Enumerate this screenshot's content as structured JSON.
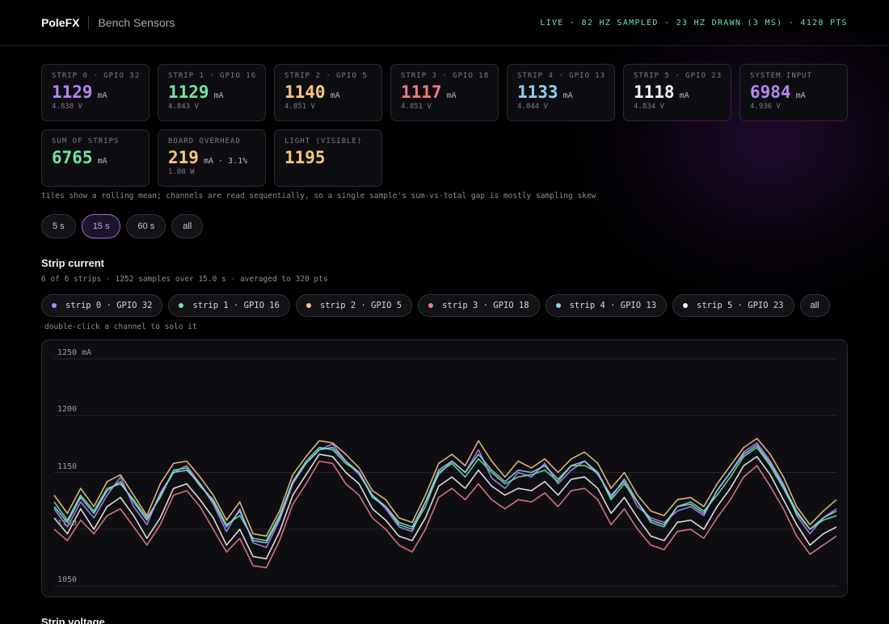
{
  "header": {
    "brand": "PoleFX",
    "subtitle": "Bench Sensors",
    "status": "LIVE · 82 HZ SAMPLED · 23 HZ DRAWN (3 MS) · 4128 PTS"
  },
  "tiles": [
    {
      "label": "STRIP 0 · GPIO 32",
      "value": "1129",
      "unit": "mA",
      "sub": "4.838 V",
      "color": "#b586f5"
    },
    {
      "label": "STRIP 1 · GPIO 16",
      "value": "1129",
      "unit": "mA",
      "sub": "4.843 V",
      "color": "#6ee7a0"
    },
    {
      "label": "STRIP 2 · GPIO 5",
      "value": "1140",
      "unit": "mA",
      "sub": "4.851 V",
      "color": "#f8c77a"
    },
    {
      "label": "STRIP 3 · GPIO 18",
      "value": "1117",
      "unit": "mA",
      "sub": "4.851 V",
      "color": "#f07a86"
    },
    {
      "label": "STRIP 4 · GPIO 13",
      "value": "1133",
      "unit": "mA",
      "sub": "4.844 V",
      "color": "#8fd0f6"
    },
    {
      "label": "STRIP 5 · GPIO 23",
      "value": "1118",
      "unit": "mA",
      "sub": "4.834 V",
      "color": "#f4f4f6"
    },
    {
      "label": "SYSTEM INPUT",
      "value": "6984",
      "unit": "mA",
      "sub": "4.936 V",
      "color": "#b586f5"
    },
    {
      "label": "SUM OF STRIPS",
      "value": "6765",
      "unit": "mA",
      "sub": "",
      "color": "#6ee7a0"
    },
    {
      "label": "BOARD OVERHEAD",
      "value": "219",
      "unit": "mA · 3.1%",
      "sub": "1.08 W",
      "color": "#f8c77a"
    },
    {
      "label": "LIGHT (VISIBLE)",
      "value": "1195",
      "unit": "",
      "sub": "",
      "color": "#f8c77a"
    }
  ],
  "note": "tiles show a rolling mean; channels are read sequentially, so a single sample's sum-vs-total gap is mostly sampling skew",
  "range_buttons": [
    {
      "label": "5 s",
      "active": false
    },
    {
      "label": "15 s",
      "active": true
    },
    {
      "label": "60 s",
      "active": false
    },
    {
      "label": "all",
      "active": false
    }
  ],
  "current_section": {
    "title": "Strip current",
    "meta": "6 of 6 strips · 1252 samples over 15.0 s · averaged to 320 pts",
    "channels": [
      {
        "label": "strip 0 · GPIO 32",
        "color": "#b586f5"
      },
      {
        "label": "strip 1 · GPIO 16",
        "color": "#6ee7a0"
      },
      {
        "label": "strip 2 · GPIO 5",
        "color": "#f8c77a"
      },
      {
        "label": "strip 3 · GPIO 18",
        "color": "#f07a86"
      },
      {
        "label": "strip 4 · GPIO 13",
        "color": "#8fd0f6"
      },
      {
        "label": "strip 5 · GPIO 23",
        "color": "#f4f4f6"
      }
    ],
    "all_label": "all",
    "hint": "double-click a channel to solo it"
  },
  "chart_data": {
    "type": "line",
    "ylabel": "mA",
    "ylim": [
      1050,
      1255
    ],
    "yticks": [
      1050,
      1100,
      1150,
      1200,
      1250
    ],
    "ytick_labels": [
      "1050",
      "1100",
      "1150",
      "1200",
      "1250 mA"
    ],
    "grid": true,
    "legend": "none",
    "x": [
      0,
      1,
      2,
      3,
      4,
      5,
      6,
      7,
      8,
      9,
      10,
      11,
      12,
      13,
      14,
      15,
      16,
      17,
      18,
      19,
      20,
      21,
      22,
      23,
      24,
      25,
      26,
      27,
      28,
      29,
      30,
      31,
      32,
      33,
      34,
      35,
      36,
      37,
      38,
      39,
      40,
      41,
      42,
      43,
      44,
      45,
      46,
      47,
      48,
      49,
      50,
      51,
      52,
      53,
      54,
      55,
      56,
      57,
      58,
      59
    ],
    "series": [
      {
        "name": "strip 0 · GPIO 32",
        "color": "#b586f5",
        "values": [
          1118,
          1102,
          1124,
          1110,
          1130,
          1146,
          1120,
          1104,
          1132,
          1150,
          1156,
          1140,
          1122,
          1098,
          1118,
          1088,
          1084,
          1108,
          1140,
          1158,
          1170,
          1175,
          1160,
          1148,
          1130,
          1118,
          1102,
          1098,
          1124,
          1148,
          1160,
          1150,
          1170,
          1145,
          1136,
          1150,
          1146,
          1158,
          1140,
          1152,
          1160,
          1148,
          1130,
          1142,
          1120,
          1110,
          1106,
          1116,
          1120,
          1112,
          1134,
          1150,
          1168,
          1176,
          1160,
          1140,
          1112,
          1096,
          1110,
          1118
        ]
      },
      {
        "name": "strip 1 · GPIO 16",
        "color": "#6ee7a0",
        "values": [
          1124,
          1108,
          1130,
          1116,
          1136,
          1140,
          1126,
          1110,
          1128,
          1152,
          1154,
          1138,
          1126,
          1104,
          1112,
          1092,
          1090,
          1112,
          1142,
          1160,
          1172,
          1170,
          1158,
          1150,
          1128,
          1120,
          1104,
          1100,
          1120,
          1150,
          1158,
          1146,
          1162,
          1150,
          1140,
          1146,
          1148,
          1152,
          1142,
          1156,
          1156,
          1150,
          1126,
          1140,
          1124,
          1106,
          1102,
          1120,
          1124,
          1116,
          1130,
          1146,
          1164,
          1172,
          1156,
          1136,
          1114,
          1100,
          1108,
          1112
        ]
      },
      {
        "name": "strip 2 · GPIO 5",
        "color": "#f8c77a",
        "values": [
          1130,
          1114,
          1136,
          1120,
          1142,
          1148,
          1130,
          1112,
          1140,
          1158,
          1160,
          1146,
          1130,
          1108,
          1124,
          1096,
          1094,
          1116,
          1148,
          1164,
          1178,
          1176,
          1166,
          1154,
          1134,
          1126,
          1110,
          1106,
          1130,
          1158,
          1166,
          1156,
          1178,
          1160,
          1146,
          1160,
          1154,
          1162,
          1150,
          1162,
          1168,
          1158,
          1136,
          1150,
          1130,
          1116,
          1112,
          1126,
          1128,
          1120,
          1140,
          1156,
          1172,
          1180,
          1166,
          1146,
          1120,
          1104,
          1116,
          1126
        ]
      },
      {
        "name": "strip 3 · GPIO 18",
        "color": "#f07a86",
        "values": [
          1100,
          1090,
          1108,
          1096,
          1112,
          1118,
          1102,
          1086,
          1104,
          1130,
          1134,
          1120,
          1100,
          1080,
          1092,
          1068,
          1066,
          1090,
          1122,
          1140,
          1160,
          1158,
          1140,
          1130,
          1110,
          1100,
          1086,
          1080,
          1100,
          1128,
          1136,
          1126,
          1140,
          1126,
          1118,
          1126,
          1124,
          1132,
          1120,
          1134,
          1136,
          1126,
          1104,
          1118,
          1100,
          1086,
          1082,
          1098,
          1100,
          1092,
          1110,
          1126,
          1146,
          1156,
          1138,
          1118,
          1094,
          1078,
          1086,
          1094
        ]
      },
      {
        "name": "strip 4 · GPIO 13",
        "color": "#8fd0f6",
        "values": [
          1120,
          1106,
          1128,
          1114,
          1134,
          1142,
          1124,
          1108,
          1130,
          1150,
          1152,
          1140,
          1124,
          1102,
          1116,
          1090,
          1088,
          1110,
          1142,
          1158,
          1170,
          1172,
          1160,
          1150,
          1130,
          1120,
          1106,
          1102,
          1124,
          1152,
          1160,
          1150,
          1166,
          1152,
          1142,
          1152,
          1150,
          1156,
          1144,
          1156,
          1160,
          1150,
          1128,
          1144,
          1124,
          1108,
          1104,
          1120,
          1122,
          1114,
          1134,
          1150,
          1166,
          1174,
          1158,
          1138,
          1116,
          1100,
          1110,
          1116
        ]
      },
      {
        "name": "strip 5 · GPIO 23",
        "color": "#f4f4f6",
        "values": [
          1110,
          1096,
          1118,
          1100,
          1120,
          1128,
          1112,
          1092,
          1110,
          1136,
          1140,
          1126,
          1110,
          1086,
          1100,
          1076,
          1074,
          1098,
          1130,
          1148,
          1166,
          1164,
          1150,
          1140,
          1118,
          1108,
          1094,
          1090,
          1110,
          1138,
          1146,
          1136,
          1152,
          1138,
          1130,
          1136,
          1134,
          1142,
          1130,
          1144,
          1146,
          1136,
          1114,
          1128,
          1110,
          1094,
          1090,
          1106,
          1108,
          1100,
          1120,
          1136,
          1156,
          1164,
          1148,
          1126,
          1104,
          1086,
          1096,
          1102
        ]
      }
    ]
  },
  "voltage_section": {
    "title": "Strip voltage"
  }
}
